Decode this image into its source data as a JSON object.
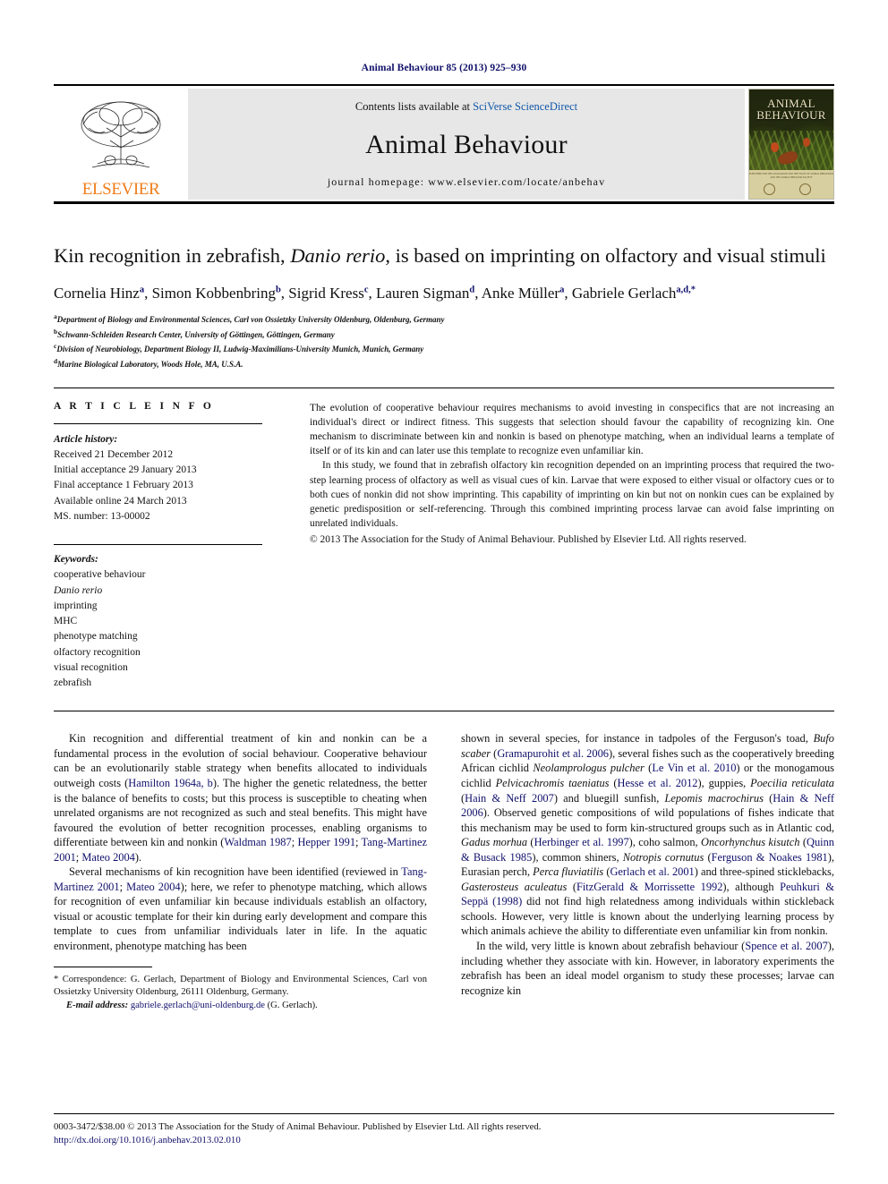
{
  "running_head": "Animal Behaviour 85 (2013) 925–930",
  "masthead": {
    "publisher_name": "ELSEVIER",
    "publisher_logo_icon": "elsevier-tree-logo",
    "contents_prefix": "Contents lists available at ",
    "contents_link": "SciVerse ScienceDirect",
    "journal_title": "Animal Behaviour",
    "homepage_label": "journal homepage: www.elsevier.com/locate/anbehav",
    "cover": {
      "line1": "ANIMAL",
      "line2": "BEHAVIOUR",
      "footer_text": "PUBLISHED FOR THE ASSOCIATION FOR THE STUDY OF ANIMAL BEHAVIOUR AND THE ANIMAL BEHAVIOR SOCIETY"
    }
  },
  "article": {
    "title_part1": "Kin recognition in zebrafish, ",
    "title_italic": "Danio rerio",
    "title_part2": ", is based on imprinting on olfactory and visual stimuli",
    "authors": [
      {
        "name": "Cornelia Hinz",
        "sup": "a",
        "sep": ", "
      },
      {
        "name": "Simon Kobbenbring",
        "sup": "b",
        "sep": ", "
      },
      {
        "name": "Sigrid Kress",
        "sup": "c",
        "sep": ", "
      },
      {
        "name": "Lauren Sigman",
        "sup": "d",
        "sep": ", "
      },
      {
        "name": "Anke Müller",
        "sup": "a",
        "sep": ", "
      },
      {
        "name": "Gabriele Gerlach",
        "sup": "a,d,*",
        "sep": ""
      }
    ],
    "affiliations": [
      {
        "marker": "a",
        "text": "Department of Biology and Environmental Sciences, Carl von Ossietzky University Oldenburg, Oldenburg, Germany"
      },
      {
        "marker": "b",
        "text": "Schwann-Schleiden Research Center, University of Göttingen, Göttingen, Germany"
      },
      {
        "marker": "c",
        "text": "Division of Neurobiology, Department Biology II, Ludwig-Maximilians-University Munich, Munich, Germany"
      },
      {
        "marker": "d",
        "text": "Marine Biological Laboratory, Woods Hole, MA, U.S.A."
      }
    ]
  },
  "article_info": {
    "heading": "A R T I C L E  I N F O",
    "history_label": "Article history:",
    "history": [
      "Received 21 December 2012",
      "Initial acceptance 29 January 2013",
      "Final acceptance 1 February 2013",
      "Available online 24 March 2013",
      "MS. number: 13-00002"
    ],
    "keywords_label": "Keywords:",
    "keywords": [
      "cooperative behaviour",
      "Danio rerio",
      "imprinting",
      "MHC",
      "phenotype matching",
      "olfactory recognition",
      "visual recognition",
      "zebrafish"
    ],
    "keyword_italic_index": 1
  },
  "abstract": {
    "paragraph1": "The evolution of cooperative behaviour requires mechanisms to avoid investing in conspecifics that are not increasing an individual's direct or indirect fitness. This suggests that selection should favour the capability of recognizing kin. One mechanism to discriminate between kin and nonkin is based on phenotype matching, when an individual learns a template of itself or of its kin and can later use this template to recognize even unfamiliar kin.",
    "paragraph2": "In this study, we found that in zebrafish olfactory kin recognition depended on an imprinting process that required the two-step learning process of olfactory as well as visual cues of kin. Larvae that were exposed to either visual or olfactory cues or to both cues of nonkin did not show imprinting. This capability of imprinting on kin but not on nonkin cues can be explained by genetic predisposition or self-referencing. Through this combined imprinting process larvae can avoid false imprinting on unrelated individuals.",
    "copyright": "© 2013 The Association for the Study of Animal Behaviour. Published by Elsevier Ltd. All rights reserved."
  },
  "body": {
    "left_col": {
      "para1_a": "Kin recognition and differential treatment of kin and nonkin can be a fundamental process in the evolution of social behaviour. Cooperative behaviour can be an evolutionarily stable strategy when benefits allocated to individuals outweigh costs (",
      "para1_cite1": "Hamilton 1964a, b",
      "para1_b": "). The higher the genetic relatedness, the better is the balance of benefits to costs; but this process is susceptible to cheating when unrelated organisms are not recognized as such and steal benefits. This might have favoured the evolution of better recognition processes, enabling organisms to differentiate between kin and nonkin (",
      "para1_cite2": "Waldman 1987",
      "para1_c": "; ",
      "para1_cite3": "Hepper 1991",
      "para1_d": "; ",
      "para1_cite4": "Tang-Martinez 2001",
      "para1_e": "; ",
      "para1_cite5": "Mateo 2004",
      "para1_f": ").",
      "para2_a": "Several mechanisms of kin recognition have been identified (reviewed in ",
      "para2_cite1": "Tang-Martinez 2001",
      "para2_b": "; ",
      "para2_cite2": "Mateo 2004",
      "para2_c": "); here, we refer to phenotype matching, which allows for recognition of even unfamiliar kin because individuals establish an olfactory, visual or acoustic template for their kin during early development and compare this template to cues from unfamiliar individuals later in life. In the aquatic environment, phenotype matching has been"
    },
    "right_col": {
      "para_a": "shown in several species, for instance in tadpoles of the Ferguson's toad, ",
      "sp1": "Bufo scaber",
      "para_b": " (",
      "cite1": "Gramapurohit et al. 2006",
      "para_c": "), several fishes such as the cooperatively breeding African cichlid ",
      "sp2": "Neolamprologus pulcher",
      "para_d": " (",
      "cite2": "Le Vin et al. 2010",
      "para_e": ") or the monogamous cichlid ",
      "sp3": "Pelvicachromis taeniatus",
      "para_f": " (",
      "cite3": "Hesse et al. 2012",
      "para_g": "), guppies, ",
      "sp4": "Poecilia reticulata",
      "para_h": " (",
      "cite4": "Hain & Neff 2007",
      "para_i": ") and bluegill sunfish, ",
      "sp5": "Lepomis macrochirus",
      "para_j": " (",
      "cite5": "Hain & Neff 2006",
      "para_k": "). Observed genetic compositions of wild populations of fishes indicate that this mechanism may be used to form kin-structured groups such as in Atlantic cod, ",
      "sp6": "Gadus morhua",
      "para_l": " (",
      "cite6": "Herbinger et al. 1997",
      "para_m": "), coho salmon, ",
      "sp7": "Oncorhynchus kisutch",
      "para_n": " (",
      "cite7": "Quinn & Busack 1985",
      "para_o": "), common shiners, ",
      "sp8": "Notropis cornutus",
      "para_p": " (",
      "cite8": "Ferguson & Noakes 1981",
      "para_q": "), Eurasian perch, ",
      "sp9": "Perca fluviatilis",
      "para_r": " (",
      "cite9": "Gerlach et al. 2001",
      "para_s": ") and three-spined sticklebacks, ",
      "sp10": "Gasterosteus aculeatus",
      "para_t": " (",
      "cite10": "FitzGerald & Morrissette 1992",
      "para_u": "), although ",
      "cite11": "Peuhkuri & Seppä (1998)",
      "para_v": " did not find high relatedness among individuals within stickleback schools. However, very little is known about the underlying learning process by which animals achieve the ability to differentiate even unfamiliar kin from nonkin.",
      "para2_a": "In the wild, very little is known about zebrafish behaviour (",
      "para2_cite1": "Spence et al. 2007",
      "para2_b": "), including whether they associate with kin. However, in laboratory experiments the zebrafish has been an ideal model organism to study these processes; larvae can recognize kin"
    }
  },
  "footnote": {
    "star": "*",
    "correspondence": " Correspondence: G. Gerlach, Department of Biology and Environmental Sciences, Carl von Ossietzky University Oldenburg, 26111 Oldenburg, Germany.",
    "email_label": "E-mail address:",
    "email": "gabriele.gerlach@uni-oldenburg.de",
    "email_suffix": " (G. Gerlach)."
  },
  "bottom": {
    "issn_line": "0003-3472/$38.00 © 2013 The Association for the Study of Animal Behaviour. Published by Elsevier Ltd. All rights reserved.",
    "doi": "http://dx.doi.org/10.1016/j.anbehav.2013.02.010"
  },
  "colors": {
    "link_blue": "#10106b",
    "sciencedirect_blue": "#1157a8",
    "elsevier_orange": "#ef7d1a",
    "masthead_gray": "#e7e7e7"
  }
}
